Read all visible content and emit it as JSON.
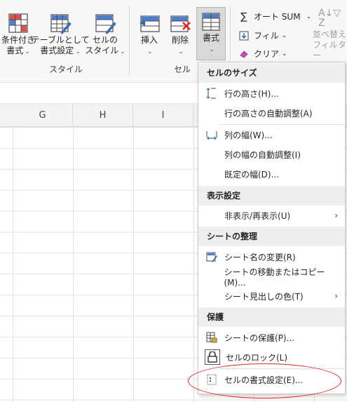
{
  "ribbon": {
    "conditional_format": {
      "line1": "条件付き",
      "line2": "書式"
    },
    "format_table": {
      "line1": "テーブルとして",
      "line2": "書式設定"
    },
    "cell_styles": {
      "line1": "セルの",
      "line2": "スタイル"
    },
    "styles_group": "スタイル",
    "insert": "挿入",
    "delete": "削除",
    "format": "書式",
    "cells_group": "セル",
    "autosum": "オート SUM",
    "fill": "フィル",
    "clear": "クリア",
    "sort_filter": {
      "line1": "並べ替え",
      "line2": "フィルター"
    }
  },
  "sheet": {
    "columns": [
      "G",
      "H",
      "I"
    ]
  },
  "menu": {
    "cell_size_header": "セルのサイズ",
    "row_height": "行の高さ(H)...",
    "autofit_row": "行の高さの自動調整(A)",
    "col_width": "列の幅(W)...",
    "autofit_col": "列の幅の自動調整(I)",
    "default_width": "既定の幅(D)...",
    "visibility_header": "表示設定",
    "hide_unhide": "非表示/再表示(U)",
    "organize_header": "シートの整理",
    "rename_sheet": "シート名の変更(R)",
    "move_copy_sheet": "シートの移動またはコピー(M)...",
    "tab_color": "シート見出しの色(T)",
    "protection_header": "保護",
    "protect_sheet": "シートの保護(P)...",
    "lock_cell": "セルのロック(L)",
    "format_cells": "セルの書式設定(E)..."
  },
  "colors": {
    "accent_red": "#e8221b",
    "icon_blue": "#2b6cb0",
    "highlight_ring": "#e8221b"
  }
}
